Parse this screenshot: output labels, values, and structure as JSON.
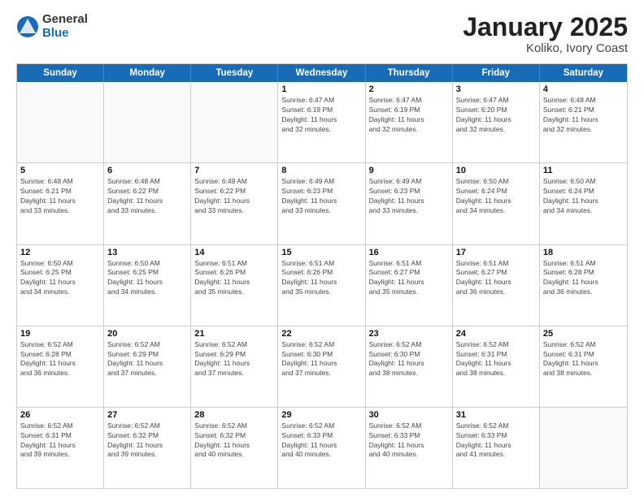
{
  "logo": {
    "general": "General",
    "blue": "Blue"
  },
  "title": "January 2025",
  "subtitle": "Koliko, Ivory Coast",
  "weekdays": [
    "Sunday",
    "Monday",
    "Tuesday",
    "Wednesday",
    "Thursday",
    "Friday",
    "Saturday"
  ],
  "weeks": [
    [
      {
        "day": "",
        "info": "",
        "empty": true
      },
      {
        "day": "",
        "info": "",
        "empty": true
      },
      {
        "day": "",
        "info": "",
        "empty": true
      },
      {
        "day": "1",
        "info": "Sunrise: 6:47 AM\nSunset: 6:19 PM\nDaylight: 11 hours\nand 32 minutes."
      },
      {
        "day": "2",
        "info": "Sunrise: 6:47 AM\nSunset: 6:19 PM\nDaylight: 11 hours\nand 32 minutes."
      },
      {
        "day": "3",
        "info": "Sunrise: 6:47 AM\nSunset: 6:20 PM\nDaylight: 11 hours\nand 32 minutes."
      },
      {
        "day": "4",
        "info": "Sunrise: 6:48 AM\nSunset: 6:21 PM\nDaylight: 11 hours\nand 32 minutes."
      }
    ],
    [
      {
        "day": "5",
        "info": "Sunrise: 6:48 AM\nSunset: 6:21 PM\nDaylight: 11 hours\nand 33 minutes."
      },
      {
        "day": "6",
        "info": "Sunrise: 6:48 AM\nSunset: 6:22 PM\nDaylight: 11 hours\nand 33 minutes."
      },
      {
        "day": "7",
        "info": "Sunrise: 6:49 AM\nSunset: 6:22 PM\nDaylight: 11 hours\nand 33 minutes."
      },
      {
        "day": "8",
        "info": "Sunrise: 6:49 AM\nSunset: 6:23 PM\nDaylight: 11 hours\nand 33 minutes."
      },
      {
        "day": "9",
        "info": "Sunrise: 6:49 AM\nSunset: 6:23 PM\nDaylight: 11 hours\nand 33 minutes."
      },
      {
        "day": "10",
        "info": "Sunrise: 6:50 AM\nSunset: 6:24 PM\nDaylight: 11 hours\nand 34 minutes."
      },
      {
        "day": "11",
        "info": "Sunrise: 6:50 AM\nSunset: 6:24 PM\nDaylight: 11 hours\nand 34 minutes."
      }
    ],
    [
      {
        "day": "12",
        "info": "Sunrise: 6:50 AM\nSunset: 6:25 PM\nDaylight: 11 hours\nand 34 minutes."
      },
      {
        "day": "13",
        "info": "Sunrise: 6:50 AM\nSunset: 6:25 PM\nDaylight: 11 hours\nand 34 minutes."
      },
      {
        "day": "14",
        "info": "Sunrise: 6:51 AM\nSunset: 6:26 PM\nDaylight: 11 hours\nand 35 minutes."
      },
      {
        "day": "15",
        "info": "Sunrise: 6:51 AM\nSunset: 6:26 PM\nDaylight: 11 hours\nand 35 minutes."
      },
      {
        "day": "16",
        "info": "Sunrise: 6:51 AM\nSunset: 6:27 PM\nDaylight: 11 hours\nand 35 minutes."
      },
      {
        "day": "17",
        "info": "Sunrise: 6:51 AM\nSunset: 6:27 PM\nDaylight: 11 hours\nand 36 minutes."
      },
      {
        "day": "18",
        "info": "Sunrise: 6:51 AM\nSunset: 6:28 PM\nDaylight: 11 hours\nand 36 minutes."
      }
    ],
    [
      {
        "day": "19",
        "info": "Sunrise: 6:52 AM\nSunset: 6:28 PM\nDaylight: 11 hours\nand 36 minutes."
      },
      {
        "day": "20",
        "info": "Sunrise: 6:52 AM\nSunset: 6:29 PM\nDaylight: 11 hours\nand 37 minutes."
      },
      {
        "day": "21",
        "info": "Sunrise: 6:52 AM\nSunset: 6:29 PM\nDaylight: 11 hours\nand 37 minutes."
      },
      {
        "day": "22",
        "info": "Sunrise: 6:52 AM\nSunset: 6:30 PM\nDaylight: 11 hours\nand 37 minutes."
      },
      {
        "day": "23",
        "info": "Sunrise: 6:52 AM\nSunset: 6:30 PM\nDaylight: 11 hours\nand 38 minutes."
      },
      {
        "day": "24",
        "info": "Sunrise: 6:52 AM\nSunset: 6:31 PM\nDaylight: 11 hours\nand 38 minutes."
      },
      {
        "day": "25",
        "info": "Sunrise: 6:52 AM\nSunset: 6:31 PM\nDaylight: 11 hours\nand 38 minutes."
      }
    ],
    [
      {
        "day": "26",
        "info": "Sunrise: 6:52 AM\nSunset: 6:31 PM\nDaylight: 11 hours\nand 39 minutes."
      },
      {
        "day": "27",
        "info": "Sunrise: 6:52 AM\nSunset: 6:32 PM\nDaylight: 11 hours\nand 39 minutes."
      },
      {
        "day": "28",
        "info": "Sunrise: 6:52 AM\nSunset: 6:32 PM\nDaylight: 11 hours\nand 40 minutes."
      },
      {
        "day": "29",
        "info": "Sunrise: 6:52 AM\nSunset: 6:33 PM\nDaylight: 11 hours\nand 40 minutes."
      },
      {
        "day": "30",
        "info": "Sunrise: 6:52 AM\nSunset: 6:33 PM\nDaylight: 11 hours\nand 40 minutes."
      },
      {
        "day": "31",
        "info": "Sunrise: 6:52 AM\nSunset: 6:33 PM\nDaylight: 11 hours\nand 41 minutes."
      },
      {
        "day": "",
        "info": "",
        "empty": true
      }
    ]
  ]
}
